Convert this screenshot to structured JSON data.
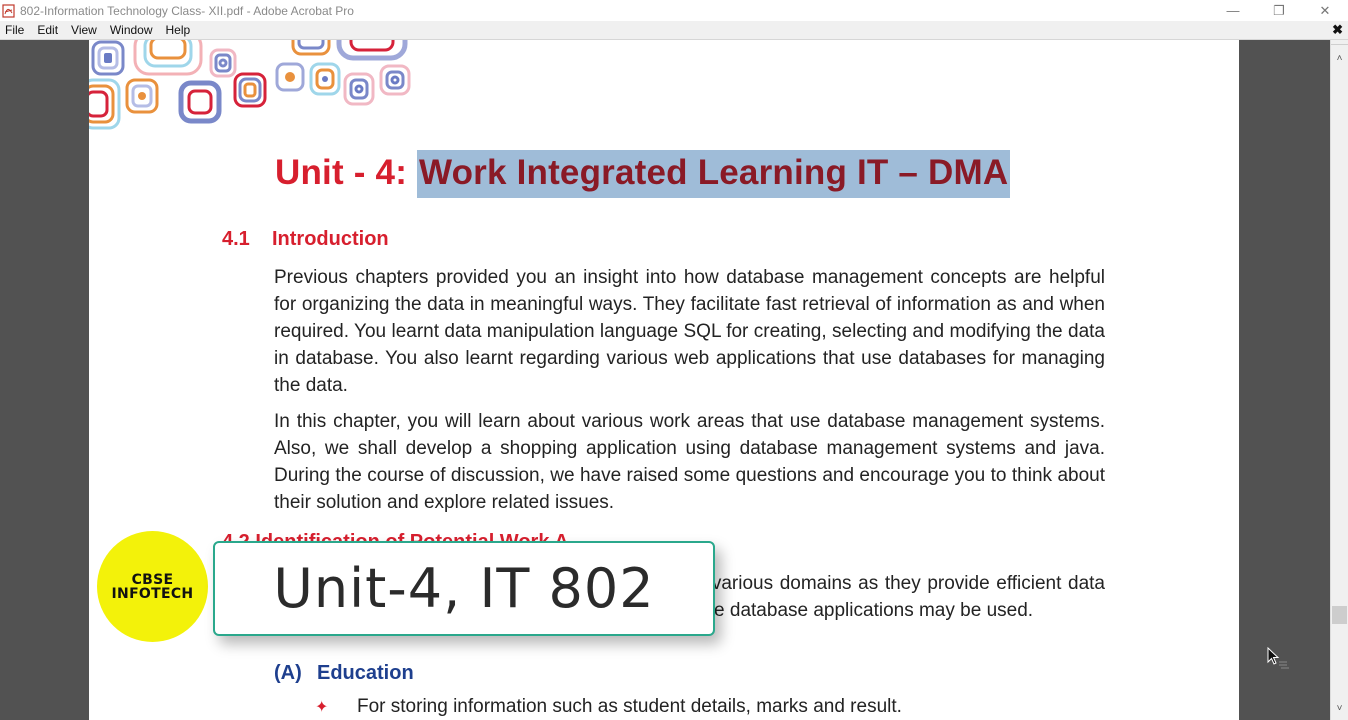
{
  "window": {
    "title": "802-Information Technology Class- XII.pdf - Adobe Acrobat Pro",
    "app_icon": "pdf-icon",
    "controls": {
      "minimize": "—",
      "restore": "❐",
      "close": "✕"
    }
  },
  "menubar": {
    "items": [
      "File",
      "Edit",
      "View",
      "Window",
      "Help"
    ],
    "close_document": "✖"
  },
  "document": {
    "unit_prefix": "Unit - 4: ",
    "unit_title_highlighted": "Work Integrated Learning IT – DMA",
    "section_4_1": {
      "number": "4.1",
      "title": "Introduction"
    },
    "paragraph_1": "Previous chapters provided you an insight into how database management concepts are helpful for organizing the data in meaningful ways. They facilitate fast retrieval of information as and when required. You learnt data manipulation language SQL for creating, selecting and modifying the data in database. You also learnt regarding various web applications that use databases for managing the data.",
    "paragraph_2": "In this chapter, you will learn about various work areas that use database management systems. Also, we shall develop a shopping application using database management systems and java. During the course of discussion, we have raised some questions and encourage you to think about their solution and explore related issues.",
    "section_4_2_partial": "4.2  Identification of Potential Work A",
    "paragraph_3": "Database management systems find application in various domains as they provide efficient data management. The following are a few domains where database applications may be used.",
    "subsection_a": {
      "label": "(A)",
      "title": "Education"
    },
    "bullet_1": "For storing information such as student details, marks and result.",
    "bullet_icon": "✦"
  },
  "overlay": {
    "logo_line1": "CBSE",
    "logo_line2": "INFOTECH",
    "caption": "Unit-4, IT 802"
  },
  "scrollbar": {
    "up": "˄",
    "down": "˅",
    "position_fraction": 0.86
  },
  "colors": {
    "heading_red": "#d71f2e",
    "highlight": "#9fbcd8",
    "subheading_blue": "#1e3f8e",
    "logo_yellow": "#f3f20a",
    "caption_border": "#2aa88c",
    "viewer_bg": "#525252"
  }
}
